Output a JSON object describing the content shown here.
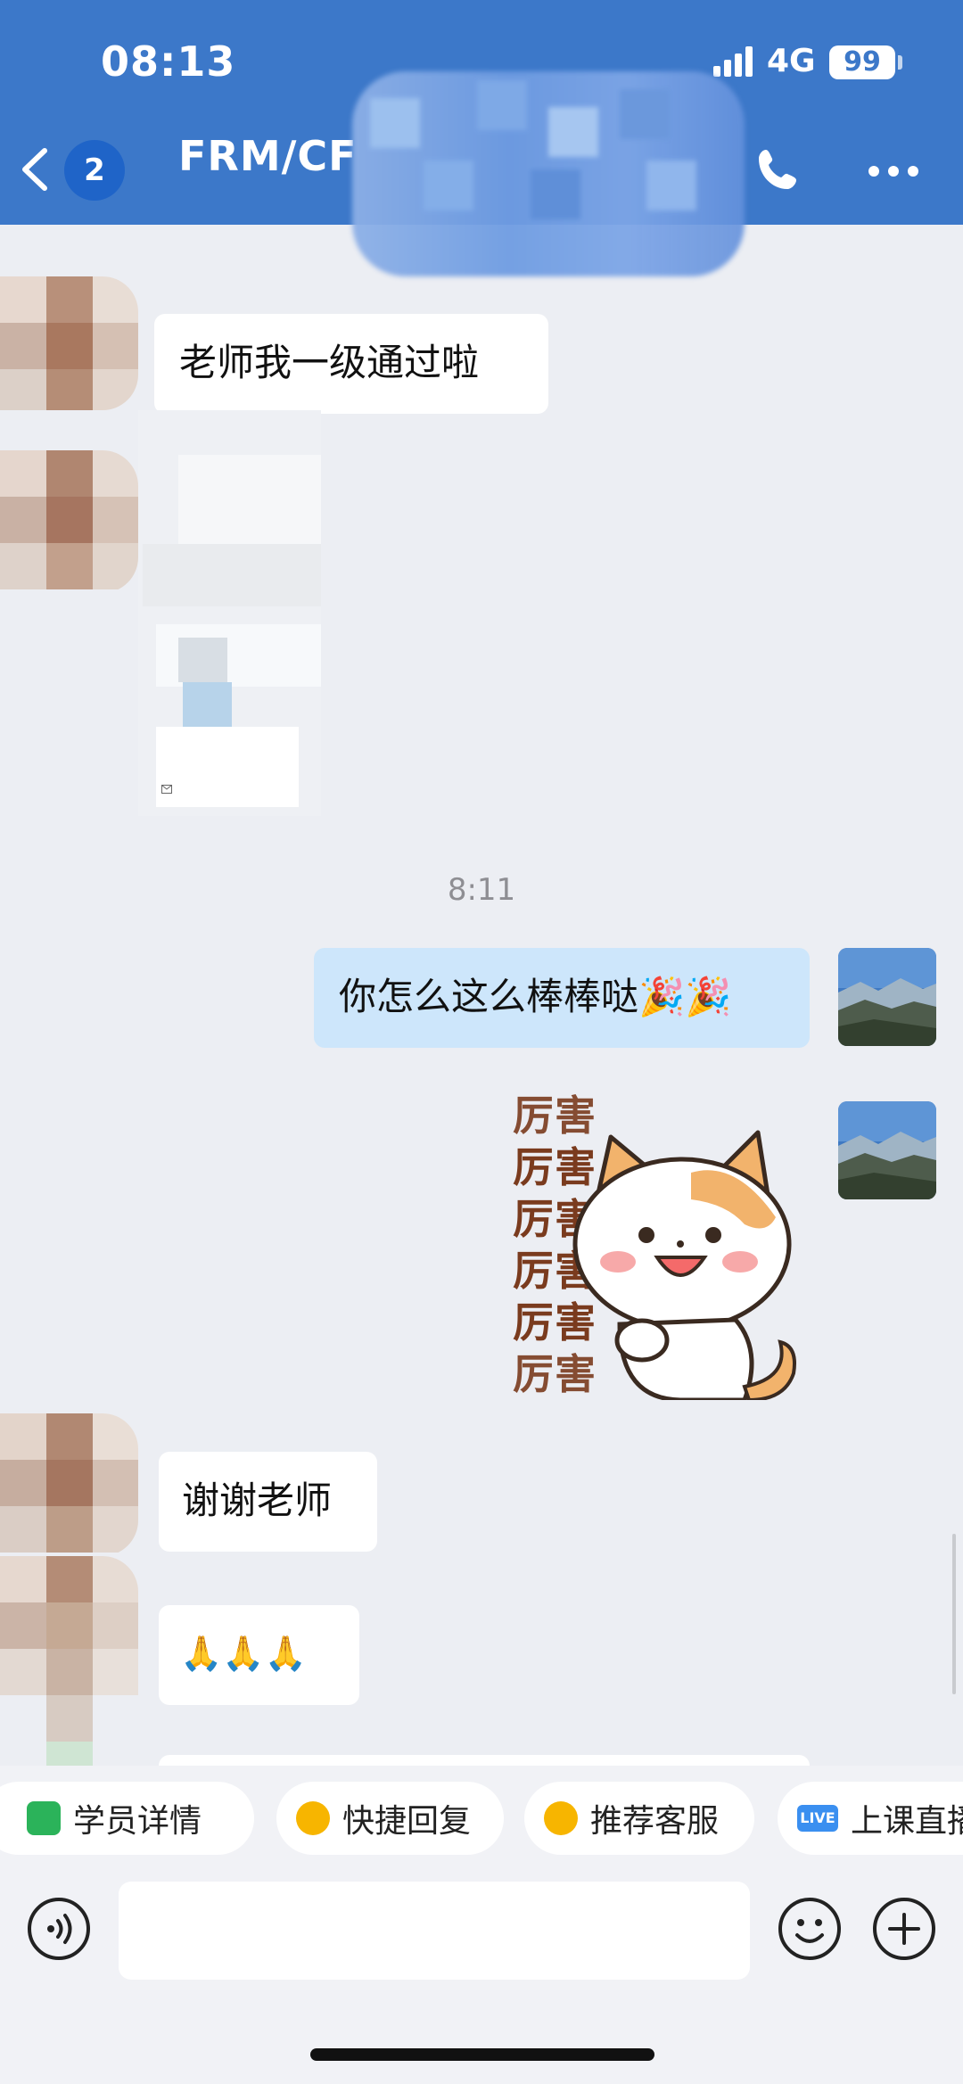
{
  "status_bar": {
    "time": "08:13",
    "network": "4G",
    "battery": "99"
  },
  "header": {
    "back_count": "2",
    "title": "FRM/CF",
    "accent_color": "#3c78c9"
  },
  "messages": [
    {
      "from": "other",
      "type": "text",
      "text": "老师我一级通过啦"
    },
    {
      "from": "other",
      "type": "image",
      "note_icon": "mail-icon"
    },
    {
      "type": "time",
      "text": "8:11"
    },
    {
      "from": "me",
      "type": "text",
      "text": "你怎么这么棒棒哒🎉🎉"
    },
    {
      "from": "me",
      "type": "sticker",
      "text": "厉害"
    },
    {
      "from": "other",
      "type": "text",
      "text": "谢谢老师"
    },
    {
      "from": "other",
      "type": "text",
      "text": "🙏🙏🙏"
    }
  ],
  "quick_actions": [
    {
      "label": "学员详情",
      "icon": "user-detail-icon"
    },
    {
      "label": "快捷回复",
      "icon": "quick-reply-icon"
    },
    {
      "label": "推荐客服",
      "icon": "service-icon"
    },
    {
      "label": "上课直播",
      "icon": "live-icon",
      "badge": "LIVE"
    }
  ],
  "input": {
    "placeholder": ""
  },
  "icons": [
    "back-chevron-icon",
    "phone-icon",
    "more-icon",
    "voice-icon",
    "emoji-icon",
    "plus-icon"
  ]
}
